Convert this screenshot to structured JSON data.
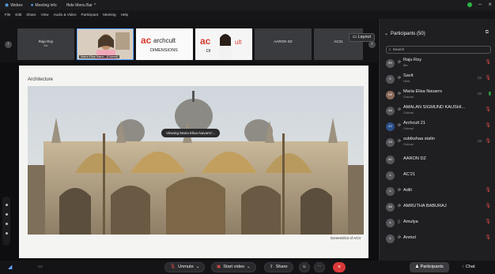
{
  "titlebar": {
    "app": "Webex",
    "meeting_info": "Meeting info",
    "hide_menu": "Hide Menu Bar",
    "hide_menu_chevron": "^",
    "status_color": "#2fb344"
  },
  "menu": [
    "File",
    "Edit",
    "Share",
    "View",
    "Audio & Video",
    "Participant",
    "Meeting",
    "Help"
  ],
  "strip": {
    "tiles": [
      {
        "name": "Raju Roy",
        "sub": "Me"
      },
      {
        "label": "Maria Elisa Nava... (Cohost)"
      },
      {
        "name": "Archcult DIMENSIONS"
      },
      {
        "name": "ac archcult DI"
      },
      {
        "name": "AARON DZ"
      },
      {
        "name": "AC21"
      }
    ],
    "layout_label": "Layout"
  },
  "slide": {
    "title": "Architecture",
    "caption": "Screenshot of ACII",
    "viewing": "Viewing Maria Elisa Navarro'..."
  },
  "panel": {
    "title": "Participants (50)",
    "search_placeholder": "Search",
    "participants": [
      {
        "initials": "RR",
        "name": "Raju Roy",
        "role": "Me"
      },
      {
        "initials": "S",
        "name": "Savit",
        "role": "Host"
      },
      {
        "initials": "ME",
        "name": "Maria Elisa Navarro",
        "role": "Cohost"
      },
      {
        "initials": "AA",
        "name": "AMALAN SIGMUND KAUSHI...",
        "role": "Cohost"
      },
      {
        "initials": "A2",
        "name": "Archcult 21",
        "role": "Cohost"
      },
      {
        "initials": "SS",
        "name": "subikshaa stalin",
        "role": "Cohost"
      },
      {
        "initials": "AD",
        "name": "AARON DZ",
        "role": ""
      },
      {
        "initials": "A",
        "name": "AC'21",
        "role": ""
      },
      {
        "initials": "A",
        "name": "Aditi",
        "role": ""
      },
      {
        "initials": "AB",
        "name": "AMRUTHA BABURAJ",
        "role": ""
      },
      {
        "initials": "A",
        "name": "Amulya",
        "role": ""
      },
      {
        "initials": "A",
        "name": "Anmol",
        "role": ""
      }
    ]
  },
  "toolbar": {
    "unmute": "Unmute",
    "start_video": "Start video",
    "share": "Share",
    "participants": "Participants",
    "chat": "Chat"
  }
}
